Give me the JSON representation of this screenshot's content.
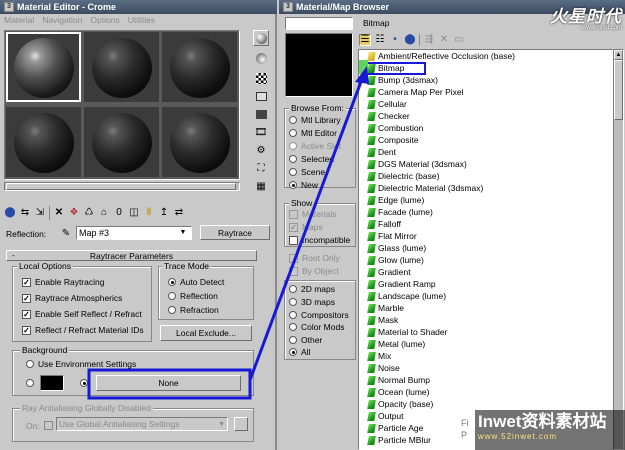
{
  "editor": {
    "title": "Material Editor - Crome",
    "menu": [
      "Material",
      "Navigation",
      "Options",
      "Utilities"
    ],
    "reflection_label": "Reflection:",
    "map_name": "Map #3",
    "map_type": "Raytrace",
    "rollout_minus": "-",
    "rollout_title": "Raytracer Parameters",
    "local_options": {
      "label": "Local Options",
      "items": [
        "Enable Raytracing",
        "Raytrace Atmospherics",
        "Enable Self Reflect / Refract",
        "Reflect / Refract Material IDs"
      ]
    },
    "trace_mode": {
      "label": "Trace Mode",
      "items": [
        "Auto Detect",
        "Reflection",
        "Refraction"
      ],
      "selected": "Auto Detect"
    },
    "local_exclude": "Local Exclude...",
    "background": {
      "label": "Background",
      "use_env": "Use Environment Settings",
      "none_button": "None"
    },
    "antialias": {
      "label": "Ray Antialiasing Globally Disabled",
      "on_label": "On:",
      "dropdown": "Use Global Antialiasing Settings"
    }
  },
  "browser": {
    "title": "Material/Map Browser",
    "name_field": "",
    "selected_name": "Bitmap",
    "browse_from": {
      "label": "Browse From:",
      "items": [
        "Mtl Library",
        "Mtl Editor",
        "Active Slot",
        "Selected",
        "Scene",
        "New"
      ],
      "selected": "New",
      "disabled": [
        "Active Slot"
      ]
    },
    "show": {
      "label": "Show",
      "items": [
        "Materials",
        "Maps",
        "Incompatible"
      ],
      "checked": [
        "Maps"
      ],
      "disabled": [
        "Materials",
        "Maps"
      ]
    },
    "root_only": "Root Only",
    "by_object": "By Object",
    "filter": {
      "items": [
        "2D maps",
        "3D maps",
        "Compositors",
        "Color Mods",
        "Other",
        "All"
      ],
      "selected": "All"
    },
    "list": [
      "Ambient/Reflective Occlusion (base)",
      "Bitmap",
      "Bump (3dsmax)",
      "Camera Map Per Pixel",
      "Cellular",
      "Checker",
      "Combustion",
      "Composite",
      "Dent",
      "DGS Material (3dsmax)",
      "Dielectric (base)",
      "Dielectric Material (3dsmax)",
      "Edge (lume)",
      "Facade (lume)",
      "Falloff",
      "Flat Mirror",
      "Glass (lume)",
      "Glow (lume)",
      "Gradient",
      "Gradient Ramp",
      "Landscape (lume)",
      "Marble",
      "Mask",
      "Material to Shader",
      "Metal (lume)",
      "Mix",
      "Noise",
      "Normal Bump",
      "Ocean (lume)",
      "Opacity (base)",
      "Output",
      "Particle Age",
      "Particle MBlur"
    ]
  },
  "watermark": {
    "top_logo": "火星时代",
    "top_url": "www.hxsd.com",
    "bottom_logo": "Inwet资料素材站",
    "bottom_url": "www.52inwet.com",
    "fi_text": "Fi",
    "p_text": "P"
  },
  "colors": {
    "title_bar": "#4a5a70",
    "highlight_blue": "#1818d8",
    "panel_gray": "#c9c9c9"
  }
}
